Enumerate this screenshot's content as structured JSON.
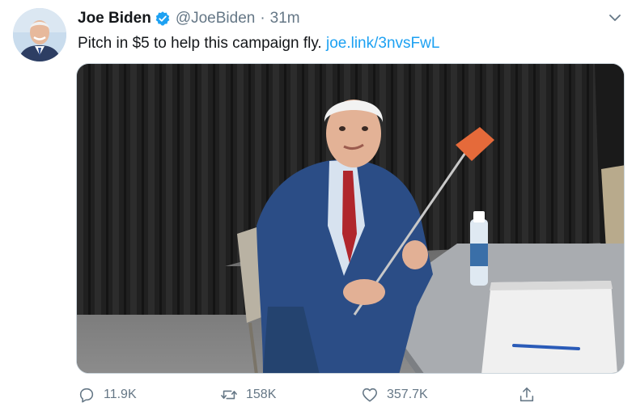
{
  "tweet": {
    "author_name": "Joe Biden",
    "handle": "@JoeBiden",
    "separator": "·",
    "time": "31m",
    "text": "Pitch in $5 to help this campaign fly. ",
    "link_text": "joe.link/3nvsFwL"
  },
  "stats": {
    "replies": "11.9K",
    "retweets": "158K",
    "likes": "357.7K"
  },
  "icons": {
    "verified": "verified-badge-icon",
    "more": "chevron-down-icon",
    "reply": "reply-icon",
    "retweet": "retweet-icon",
    "like": "heart-icon",
    "share": "share-icon"
  },
  "colors": {
    "link": "#1da1f2",
    "secondary_text": "#657786",
    "verified": "#1da1f2"
  }
}
